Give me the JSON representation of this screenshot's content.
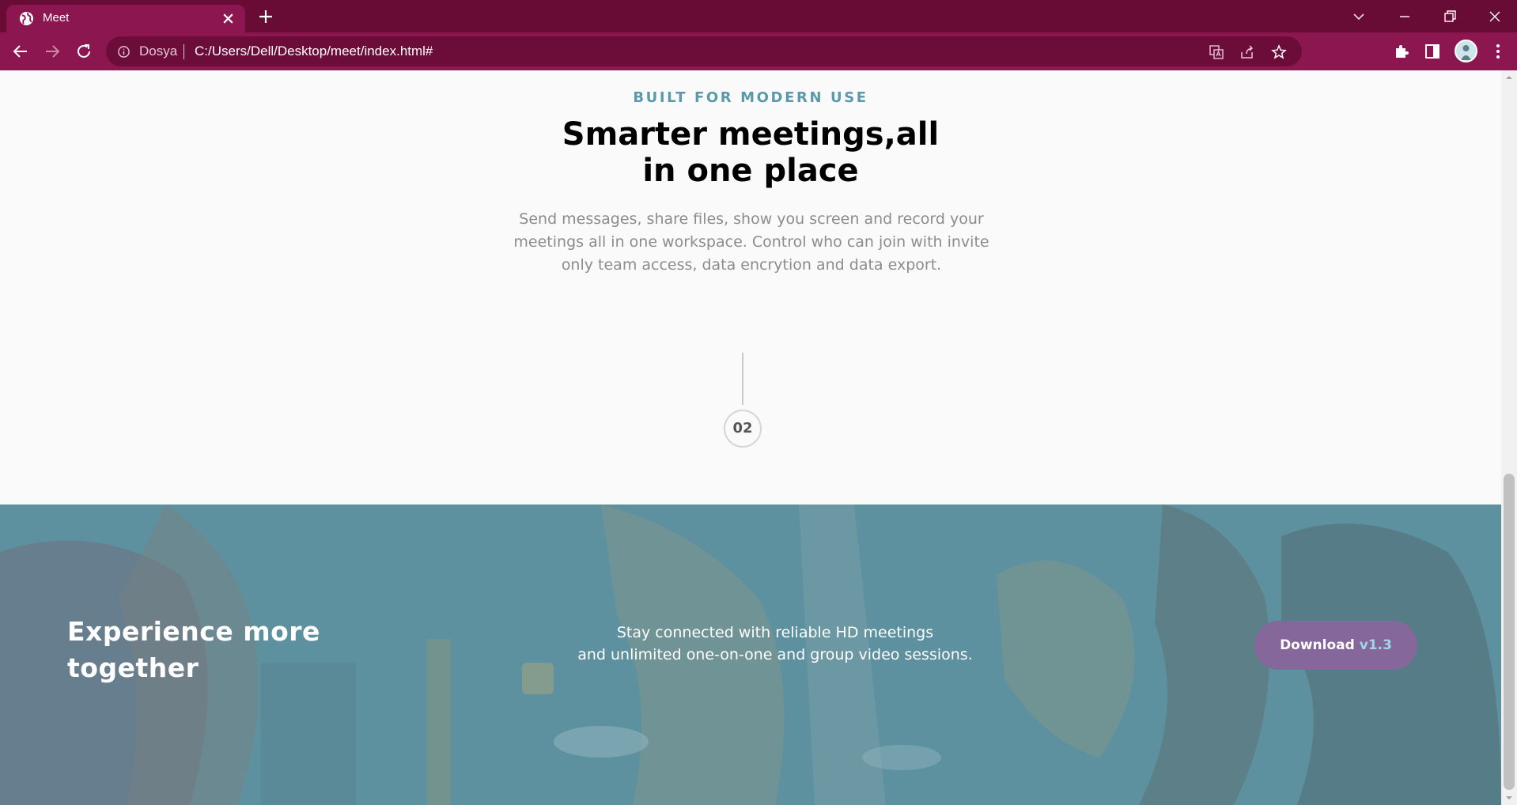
{
  "browser": {
    "tab_title": "Meet",
    "site_chip": "Dosya",
    "url": "C:/Users/Dell/Desktop/meet/index.html#"
  },
  "features": {
    "eyebrow": "BUILT FOR MODERN USE",
    "headline_line1": "Smarter meetings,all",
    "headline_line2": "in one place",
    "description": "Send messages, share files, show you screen and record your meetings all in one workspace. Control who can join with invite only team access, data encrytion and data export.",
    "step_number": "02"
  },
  "hero": {
    "title_line1": "Experience more",
    "title_line2": "together",
    "text_line1": "Stay connected with reliable HD meetings",
    "text_line2": "and unlimited one-on-one and group video sessions.",
    "download_label": "Download",
    "download_version": "v1.3"
  }
}
